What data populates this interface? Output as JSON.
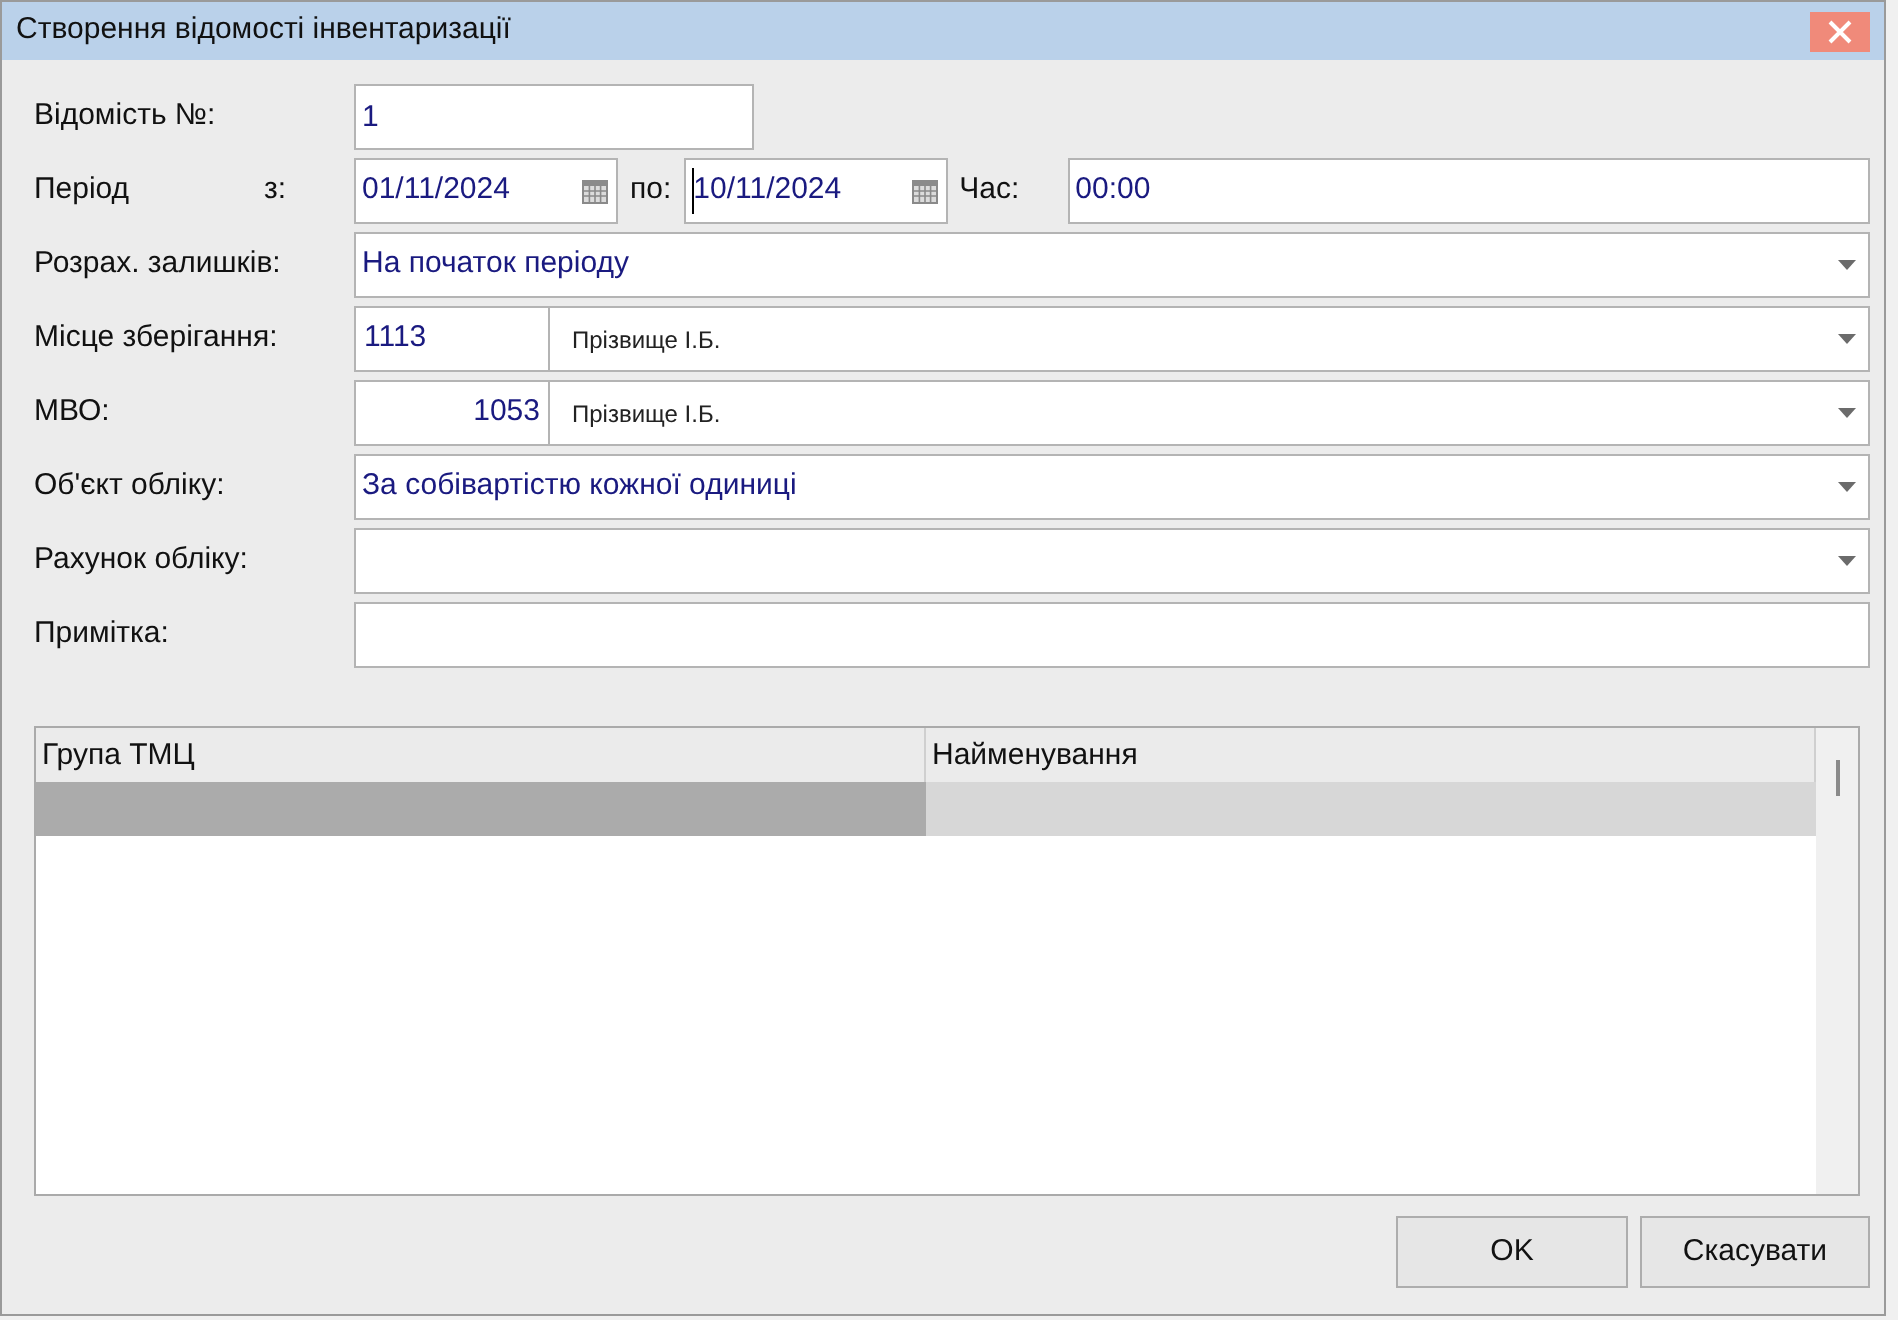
{
  "window": {
    "title": "Створення відомості інвентаризації"
  },
  "fields": [
    {
      "kind": "short_text",
      "label": "Відомість №:",
      "value": "1"
    },
    {
      "kind": "period",
      "label": "Період",
      "from_label": "з:",
      "from": "01/11/2024",
      "to_label": "по:",
      "to": "10/11/2024",
      "to_focused": true,
      "time_label": "Час:",
      "time": "00:00"
    },
    {
      "kind": "select",
      "label": "Розрах. залишків:",
      "value": "На початок періоду"
    },
    {
      "kind": "code_select",
      "label": "Місце зберігання:",
      "code": "1113",
      "right_aligned": false,
      "name": "Прізвище І.Б."
    },
    {
      "kind": "code_select",
      "label": "МВО:",
      "code": "1053",
      "right_aligned": true,
      "name": "Прізвище І.Б."
    },
    {
      "kind": "select",
      "label": "Об'єкт обліку:",
      "value": "За собівартістю кожної одиниці"
    },
    {
      "kind": "select",
      "label": "Рахунок обліку:"
    },
    {
      "kind": "text",
      "label": "Примітка:"
    }
  ],
  "table": {
    "columns": [
      "Група ТМЦ",
      "Найменування"
    ],
    "rows": [
      {
        "selected": true
      }
    ]
  },
  "buttons": [
    "OK",
    "Скасувати"
  ]
}
